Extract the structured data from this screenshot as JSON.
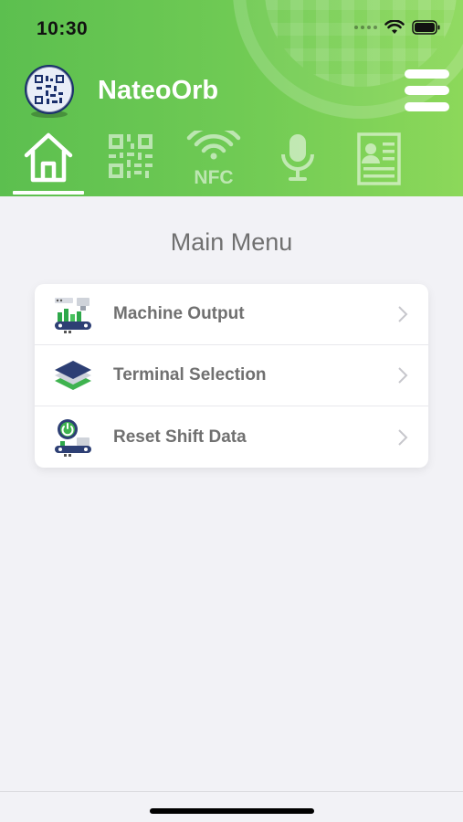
{
  "status_bar": {
    "time": "10:30"
  },
  "header": {
    "app_title": "NateoOrb",
    "logo_icon": "qr-orb-logo-icon",
    "menu_icon": "hamburger-menu-icon"
  },
  "tabs": [
    {
      "name": "home",
      "icon": "home-icon",
      "label": "",
      "active": true
    },
    {
      "name": "qr",
      "icon": "qr-code-icon",
      "label": ""
    },
    {
      "name": "nfc",
      "icon": "nfc-icon",
      "label": "NFC"
    },
    {
      "name": "voice",
      "icon": "microphone-icon",
      "label": ""
    },
    {
      "name": "profile",
      "icon": "id-card-icon",
      "label": ""
    }
  ],
  "main": {
    "title": "Main Menu",
    "items": [
      {
        "label": "Machine Output",
        "icon": "machine-output-icon"
      },
      {
        "label": "Terminal Selection",
        "icon": "layers-stack-icon"
      },
      {
        "label": "Reset Shift Data",
        "icon": "reset-power-icon"
      }
    ]
  },
  "colors": {
    "header_start": "#5cbf4f",
    "header_end": "#8cd85a",
    "text_gray": "#707070",
    "background": "#f2f2f6"
  }
}
